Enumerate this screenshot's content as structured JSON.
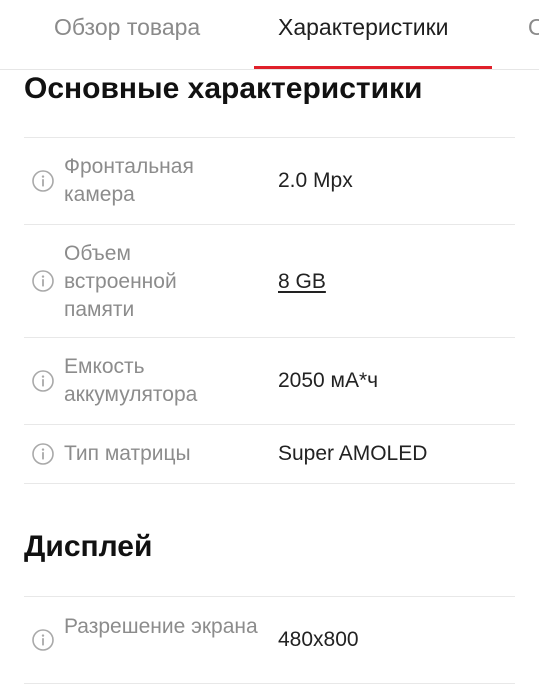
{
  "tabs": [
    {
      "label": "Обзор товара",
      "active": false
    },
    {
      "label": "Характеристики",
      "active": true
    },
    {
      "label": "О",
      "active": false
    }
  ],
  "accent_color": "#e0202a",
  "sections": [
    {
      "title": "Основные характеристики",
      "rows": [
        {
          "label": "Фронтальная камера",
          "value": "2.0 Mpx",
          "icon": "info-icon"
        },
        {
          "label": "Объем встроенной памяти",
          "value": "8 GB",
          "icon": "info-icon",
          "link": true
        },
        {
          "label": "Емкость аккумулятора",
          "value": "2050 мА*ч",
          "icon": "info-icon"
        },
        {
          "label": "Тип матрицы",
          "value": "Super AMOLED",
          "icon": "info-icon"
        }
      ]
    },
    {
      "title": "Дисплей",
      "rows": [
        {
          "label": "Разрешение экрана",
          "value": "480x800",
          "icon": "info-icon"
        }
      ]
    }
  ]
}
